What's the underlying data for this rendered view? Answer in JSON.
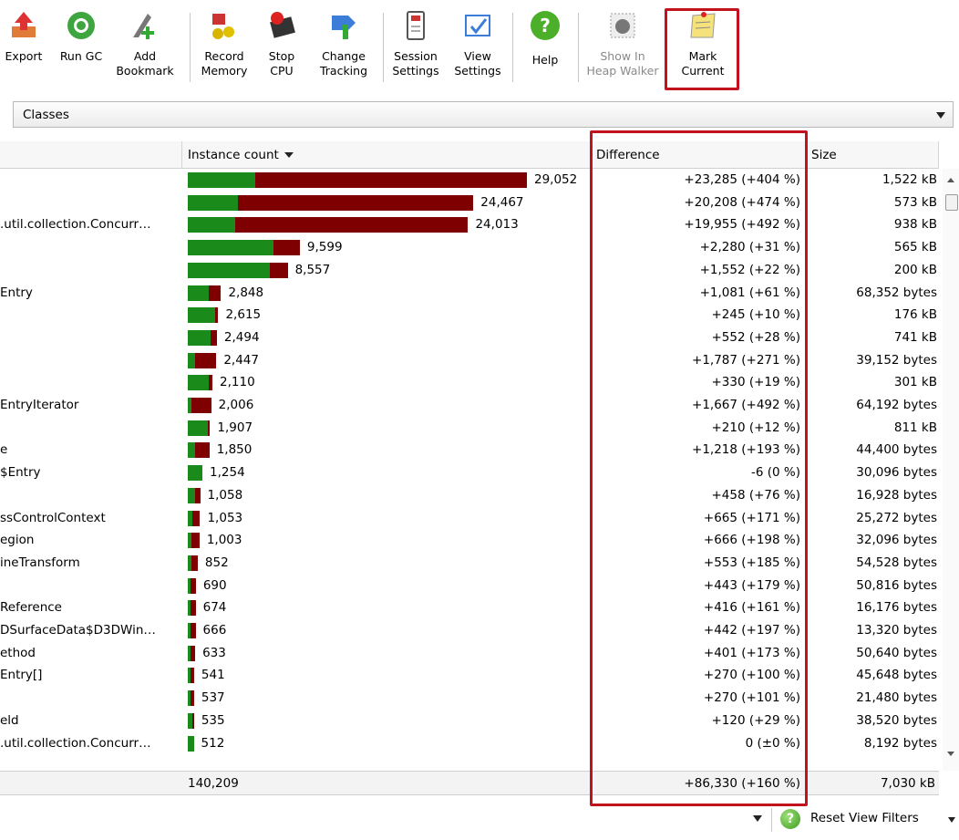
{
  "toolbar": {
    "export": "Export",
    "run_gc": "Run GC",
    "add_bookmark": "Add\nBookmark",
    "record_memory": "Record\nMemory",
    "stop_cpu": "Stop\nCPU",
    "change_tracking": "Change\nTracking",
    "session_settings": "Session\nSettings",
    "view_settings": "View\nSettings",
    "help": "Help",
    "show_in_heap_walker": "Show In\nHeap Walker",
    "mark_current": "Mark\nCurrent"
  },
  "view": {
    "selected": "Classes"
  },
  "columns": {
    "instance_count": "Instance count",
    "difference": "Difference",
    "size": "Size"
  },
  "rows": [
    {
      "cls": "",
      "count": "29,052",
      "diff": "+23,285 (+404 %)",
      "size": "1,522 kB",
      "count_value": 29052,
      "green_value": 5767
    },
    {
      "cls": "",
      "count": "24,467",
      "diff": "+20,208 (+474 %)",
      "size": "573 kB",
      "count_value": 24467,
      "green_value": 4259
    },
    {
      "cls": ".util.collection.Concurr…",
      "count": "24,013",
      "diff": "+19,955 (+492 %)",
      "size": "938 kB",
      "count_value": 24013,
      "green_value": 4058
    },
    {
      "cls": "",
      "count": "9,599",
      "diff": "+2,280 (+31 %)",
      "size": "565 kB",
      "count_value": 9599,
      "green_value": 7319
    },
    {
      "cls": "",
      "count": "8,557",
      "diff": "+1,552 (+22 %)",
      "size": "200 kB",
      "count_value": 8557,
      "green_value": 7005
    },
    {
      "cls": "Entry",
      "count": "2,848",
      "diff": "+1,081 (+61 %)",
      "size": "68,352 bytes",
      "count_value": 2848,
      "green_value": 1767
    },
    {
      "cls": "",
      "count": "2,615",
      "diff": "+245 (+10 %)",
      "size": "176 kB",
      "count_value": 2615,
      "green_value": 2370
    },
    {
      "cls": "",
      "count": "2,494",
      "diff": "+552 (+28 %)",
      "size": "741 kB",
      "count_value": 2494,
      "green_value": 1942
    },
    {
      "cls": "",
      "count": "2,447",
      "diff": "+1,787 (+271 %)",
      "size": "39,152 bytes",
      "count_value": 2447,
      "green_value": 660
    },
    {
      "cls": "",
      "count": "2,110",
      "diff": "+330 (+19 %)",
      "size": "301 kB",
      "count_value": 2110,
      "green_value": 1780
    },
    {
      "cls": "EntryIterator",
      "count": "2,006",
      "diff": "+1,667 (+492 %)",
      "size": "64,192 bytes",
      "count_value": 2006,
      "green_value": 339
    },
    {
      "cls": "",
      "count": "1,907",
      "diff": "+210 (+12 %)",
      "size": "811 kB",
      "count_value": 1907,
      "green_value": 1697
    },
    {
      "cls": "e",
      "count": "1,850",
      "diff": "+1,218 (+193 %)",
      "size": "44,400 bytes",
      "count_value": 1850,
      "green_value": 632
    },
    {
      "cls": "$Entry",
      "count": "1,254",
      "diff": "-6 (0 %)",
      "size": "30,096 bytes",
      "count_value": 1254,
      "green_value": 1254
    },
    {
      "cls": "",
      "count": "1,058",
      "diff": "+458 (+76 %)",
      "size": "16,928 bytes",
      "count_value": 1058,
      "green_value": 600
    },
    {
      "cls": "ssControlContext",
      "count": "1,053",
      "diff": "+665 (+171 %)",
      "size": "25,272 bytes",
      "count_value": 1053,
      "green_value": 388
    },
    {
      "cls": "egion",
      "count": "1,003",
      "diff": "+666 (+198 %)",
      "size": "32,096 bytes",
      "count_value": 1003,
      "green_value": 337
    },
    {
      "cls": "ineTransform",
      "count": "852",
      "diff": "+553 (+185 %)",
      "size": "54,528 bytes",
      "count_value": 852,
      "green_value": 299
    },
    {
      "cls": "",
      "count": "690",
      "diff": "+443 (+179 %)",
      "size": "50,816 bytes",
      "count_value": 690,
      "green_value": 247
    },
    {
      "cls": "Reference",
      "count": "674",
      "diff": "+416 (+161 %)",
      "size": "16,176 bytes",
      "count_value": 674,
      "green_value": 258
    },
    {
      "cls": "DSurfaceData$D3DWin…",
      "count": "666",
      "diff": "+442 (+197 %)",
      "size": "13,320 bytes",
      "count_value": 666,
      "green_value": 224
    },
    {
      "cls": "ethod",
      "count": "633",
      "diff": "+401 (+173 %)",
      "size": "50,640 bytes",
      "count_value": 633,
      "green_value": 232
    },
    {
      "cls": "Entry[]",
      "count": "541",
      "diff": "+270 (+100 %)",
      "size": "45,648 bytes",
      "count_value": 541,
      "green_value": 271
    },
    {
      "cls": "",
      "count": "537",
      "diff": "+270 (+101 %)",
      "size": "21,480 bytes",
      "count_value": 537,
      "green_value": 267
    },
    {
      "cls": "eld",
      "count": "535",
      "diff": "+120 (+29 %)",
      "size": "38,520 bytes",
      "count_value": 535,
      "green_value": 415
    },
    {
      "cls": ".util.collection.Concurr…",
      "count": "512",
      "diff": "0 (±0 %)",
      "size": "8,192 bytes",
      "count_value": 512,
      "green_value": 512
    }
  ],
  "totals": {
    "count": "140,209",
    "diff": "+86,330 (+160 %)",
    "size": "7,030 kB"
  },
  "bottom": {
    "reset_filters": "Reset View Filters"
  },
  "colors": {
    "old_instances": "#1a8a1a",
    "new_instances": "#7e0000",
    "highlight": "#c2121e"
  }
}
